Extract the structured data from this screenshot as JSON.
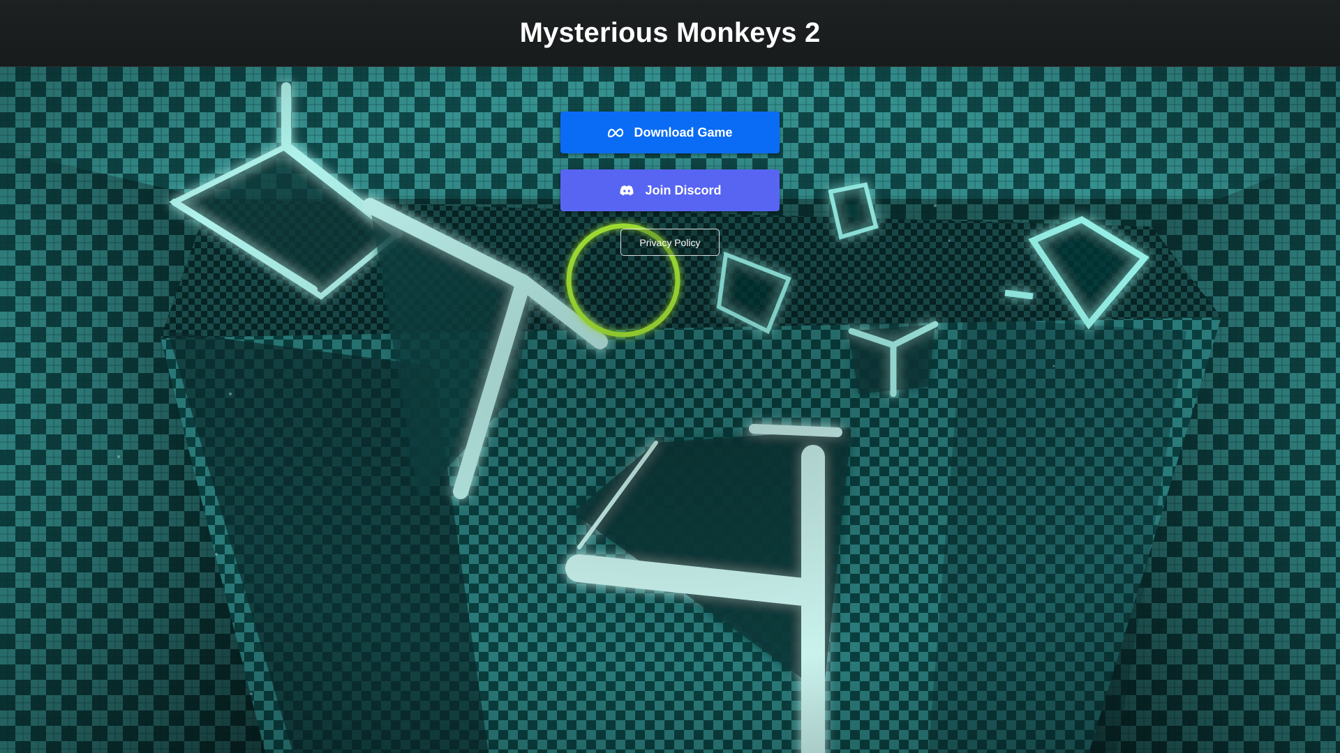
{
  "header": {
    "title": "Mysterious Monkeys 2"
  },
  "actions": {
    "download": {
      "label": "Download Game",
      "icon": "meta-logo-icon",
      "color": "#0a6cf5"
    },
    "discord": {
      "label": "Join Discord",
      "icon": "discord-logo-icon",
      "color": "#5865f2"
    },
    "privacy": {
      "label": "Privacy Policy"
    }
  },
  "scene": {
    "colors": {
      "teal_light": "#3aa7a5",
      "teal_dark": "#0e4a4b",
      "glow": "#7ffcf2",
      "ring": "#b6ff3a"
    }
  }
}
